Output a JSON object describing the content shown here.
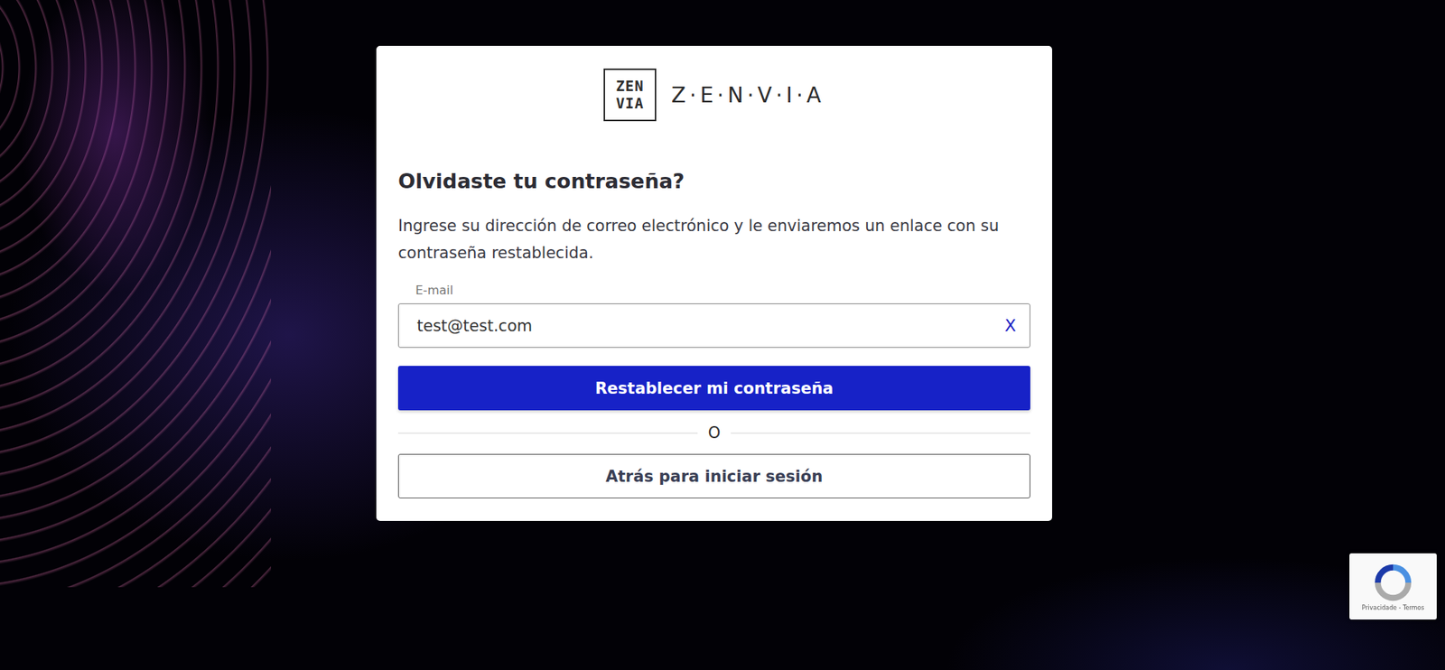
{
  "logo": {
    "mark": [
      "ZEN",
      "VIA"
    ],
    "wordmark": "Z·E·N·V·I·A"
  },
  "title": "Olvidaste tu contraseña?",
  "description": "Ingrese su dirección de correo electrónico y le enviaremos un enlace con su contraseña restablecida.",
  "email_field": {
    "label": "E-mail",
    "value": "test@test.com",
    "clear": "X"
  },
  "primary_button": "Restablecer mi contraseña",
  "divider": "O",
  "secondary_button": "Atrás para iniciar sesión",
  "recaptcha": {
    "links": "Privacidade - Termos"
  }
}
